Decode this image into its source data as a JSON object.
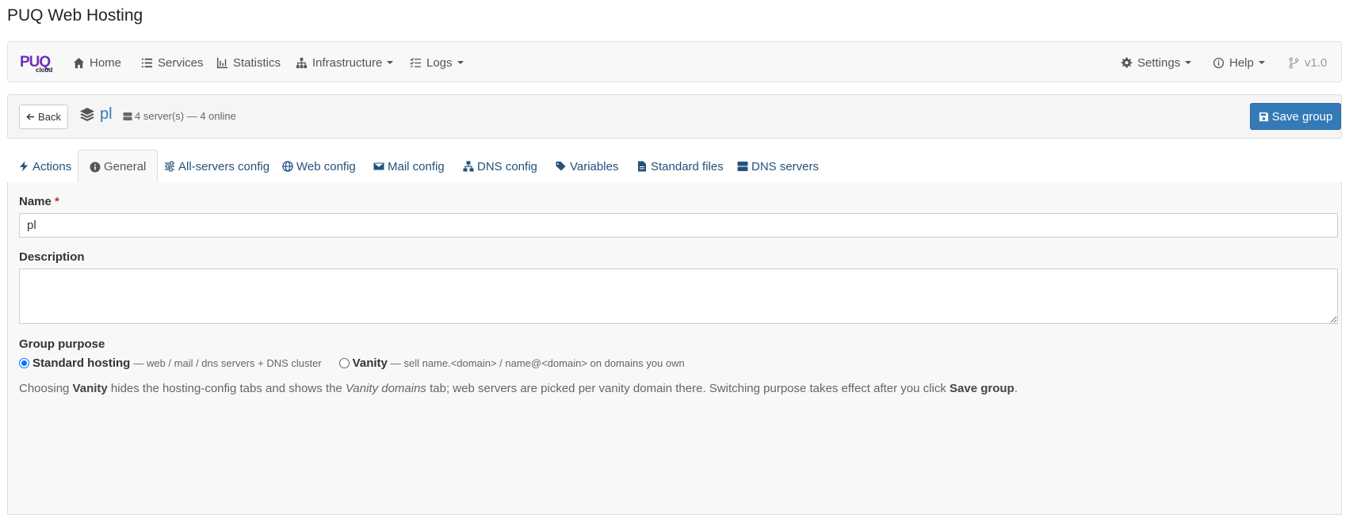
{
  "app": {
    "title": "PUQ Web Hosting"
  },
  "nav": {
    "logo_text": "PUQ",
    "logo_sub": "cloud",
    "items": [
      {
        "label": "Home",
        "icon": "home-icon"
      },
      {
        "label": "Services",
        "icon": "list-icon"
      },
      {
        "label": "Statistics",
        "icon": "chart-icon"
      },
      {
        "label": "Infrastructure",
        "icon": "sitemap-icon",
        "dropdown": true
      },
      {
        "label": "Logs",
        "icon": "tasks-icon",
        "dropdown": true
      }
    ],
    "right": [
      {
        "label": "Settings",
        "icon": "gear-icon",
        "dropdown": true
      },
      {
        "label": "Help",
        "icon": "info-icon",
        "dropdown": true
      },
      {
        "label": "v1.0",
        "icon": "git-branch-icon"
      }
    ]
  },
  "group": {
    "back_label": "Back",
    "name": "pl",
    "server_status": "4 server(s) — 4 online",
    "save_label": "Save group"
  },
  "tabs": [
    {
      "label": "Actions",
      "icon": "bolt-icon",
      "active": false
    },
    {
      "label": "General",
      "icon": "info-circle-icon",
      "active": true
    },
    {
      "label": "All-servers config",
      "icon": "sliders-icon",
      "active": false
    },
    {
      "label": "Web config",
      "icon": "globe-icon",
      "active": false
    },
    {
      "label": "Mail config",
      "icon": "envelope-icon",
      "active": false
    },
    {
      "label": "DNS config",
      "icon": "network-icon",
      "active": false
    },
    {
      "label": "Variables",
      "icon": "tags-icon",
      "active": false
    },
    {
      "label": "Standard files",
      "icon": "file-icon",
      "active": false
    },
    {
      "label": "DNS servers",
      "icon": "server-icon",
      "active": false
    }
  ],
  "form": {
    "name_label": "Name",
    "name_required": "*",
    "name_value": "pl",
    "description_label": "Description",
    "description_value": "",
    "purpose_label": "Group purpose",
    "purpose_options": [
      {
        "label": "Standard hosting",
        "hint": "— web / mail / dns servers + DNS cluster",
        "checked": true
      },
      {
        "label": "Vanity",
        "hint": "— sell name.<domain> / name@<domain> on domains you own",
        "checked": false
      }
    ],
    "help": {
      "p1": "Choosing ",
      "b1": "Vanity",
      "p2": " hides the hosting-config tabs and shows the ",
      "i1": "Vanity domains",
      "p3": " tab; web servers are picked per vanity domain there. Switching purpose takes effect after you click ",
      "b2": "Save group",
      "p4": "."
    }
  },
  "colors": {
    "primary": "#337ab7",
    "link": "#23527c",
    "logo": "#6f2dbd"
  }
}
